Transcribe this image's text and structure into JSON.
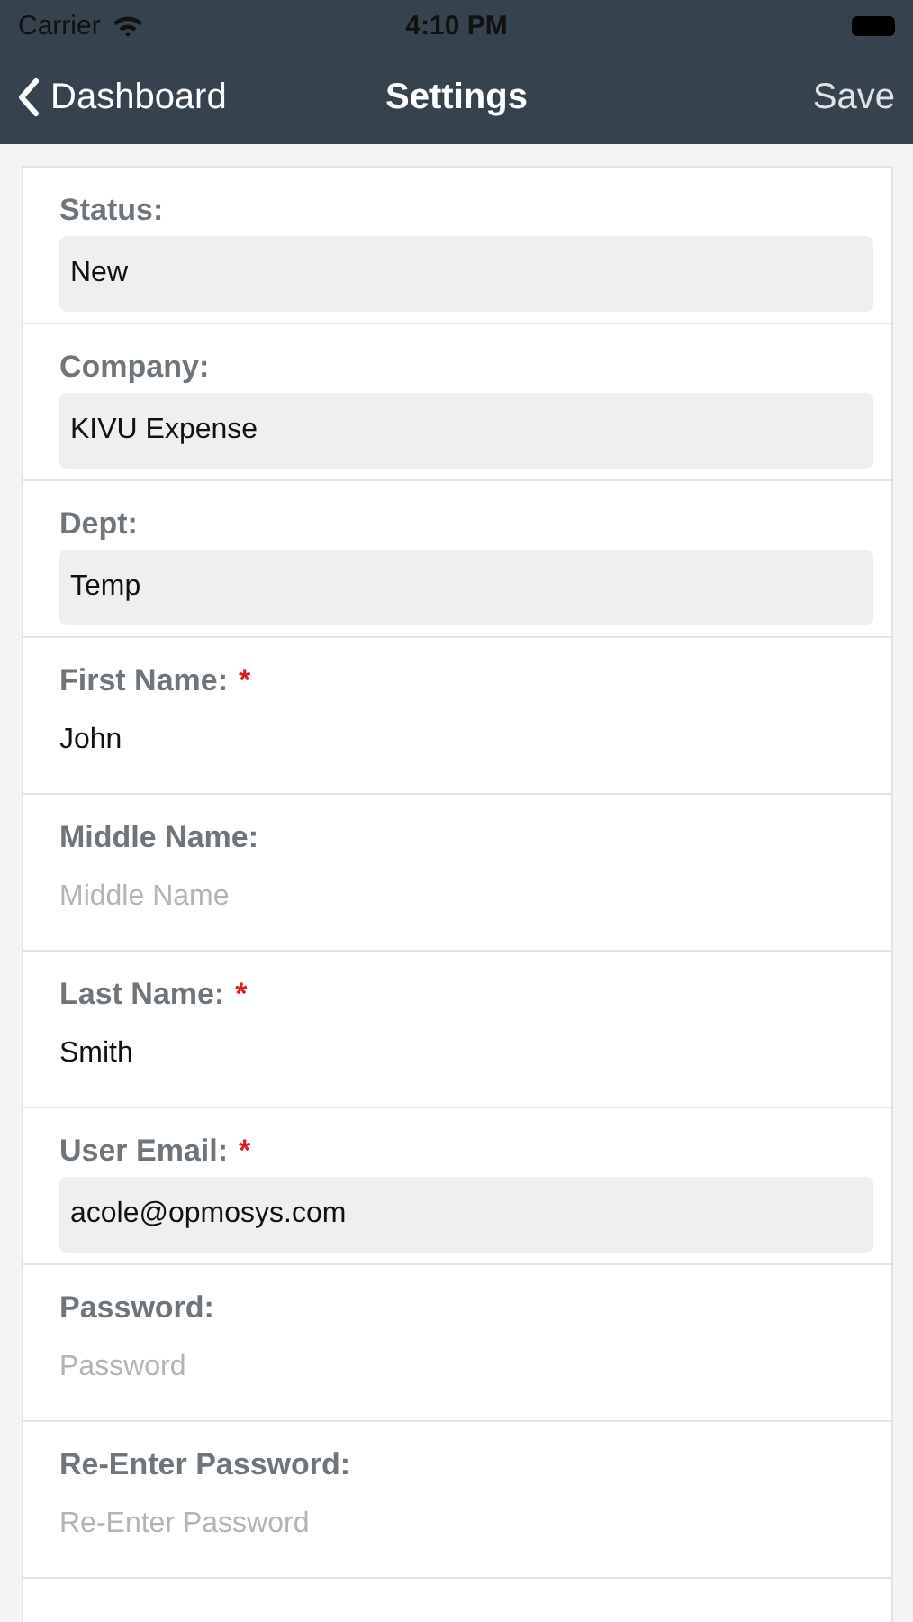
{
  "status_bar": {
    "carrier": "Carrier",
    "time": "4:10 PM"
  },
  "nav": {
    "back": "Dashboard",
    "title": "Settings",
    "action": "Save"
  },
  "fields": [
    {
      "label": "Status:",
      "kind": "shaded",
      "value": "New"
    },
    {
      "label": "Company:",
      "kind": "shaded",
      "value": "KIVU Expense"
    },
    {
      "label": "Dept:",
      "kind": "shaded",
      "value": "Temp"
    },
    {
      "label": "First Name:",
      "required_mark": "*",
      "kind": "plain",
      "value": "John"
    },
    {
      "label": "Middle Name:",
      "kind": "plain",
      "placeholder": "Middle Name"
    },
    {
      "label": "Last Name:",
      "required_mark": "*",
      "kind": "plain",
      "value": "Smith"
    },
    {
      "label": "User Email:",
      "required_mark": "*",
      "kind": "shaded",
      "value": "acole@opmosys.com"
    },
    {
      "label": "Password:",
      "kind": "plain",
      "placeholder": "Password"
    },
    {
      "label": "Re-Enter Password:",
      "kind": "plain",
      "placeholder": "Re-Enter Password"
    }
  ]
}
